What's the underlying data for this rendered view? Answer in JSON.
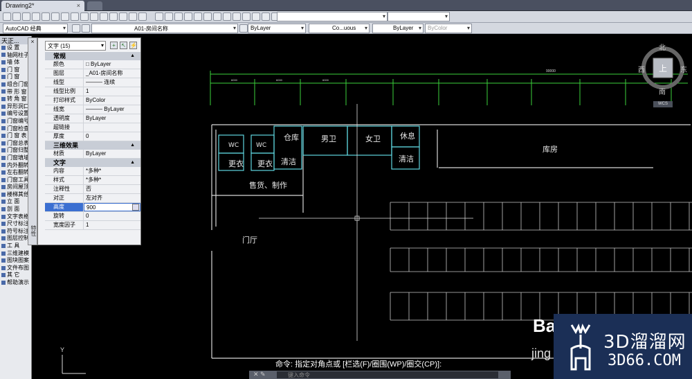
{
  "tabs": {
    "drawing": "Drawing2*",
    "close": "×"
  },
  "toolbar2": {
    "workspace": "AutoCAD 经典",
    "layer": "A01-房间名称",
    "color": "ByLayer",
    "linetype": "Co...uous",
    "lineweight": "ByLayer",
    "plotstyle": "ByColor"
  },
  "left_palette": {
    "header": "天正...",
    "items": [
      "设 置",
      "轴网柱子",
      "墙 体",
      "门 窗",
      "门 窗",
      "组合门窗",
      "带 形 窗",
      "转 角 窗",
      "异形洞口",
      "编号设置",
      "门窗编号",
      "门窗检查",
      "门 窗 表",
      "门窗总表",
      "门窗归整",
      "门窗填墙",
      "内外翻转",
      "左右翻转",
      "门窗工具",
      "房间屋顶",
      "楼梯其他",
      "立 面",
      "剖 面",
      "文字表格",
      "尺寸标注",
      "符号标注",
      "图层控制",
      "工 具",
      "三维建模",
      "图块图案",
      "文件布图",
      "其 它",
      "帮助演示"
    ]
  },
  "side_strip": {
    "close": "×",
    "label": "特性"
  },
  "properties": {
    "selector": "文字 (15)",
    "sections": [
      {
        "title": "常规",
        "rows": [
          {
            "k": "颜色",
            "v": "□ ByLayer"
          },
          {
            "k": "图层",
            "v": "_A01-房间名称"
          },
          {
            "k": "线型",
            "v": "——— 连续"
          },
          {
            "k": "线型比例",
            "v": "1"
          },
          {
            "k": "打印样式",
            "v": "ByColor"
          },
          {
            "k": "线宽",
            "v": "——— ByLayer"
          },
          {
            "k": "透明度",
            "v": "ByLayer"
          },
          {
            "k": "超链接",
            "v": ""
          },
          {
            "k": "厚度",
            "v": "0"
          }
        ]
      },
      {
        "title": "三维效果",
        "rows": [
          {
            "k": "材质",
            "v": "ByLayer"
          }
        ]
      },
      {
        "title": "文字",
        "rows": [
          {
            "k": "内容",
            "v": "*多种*"
          },
          {
            "k": "样式",
            "v": "*多种*"
          },
          {
            "k": "注释性",
            "v": "否"
          },
          {
            "k": "对正",
            "v": "左对齐"
          },
          {
            "k": "高度",
            "v": "900"
          },
          {
            "k": "旋转",
            "v": "0"
          },
          {
            "k": "宽度因子",
            "v": "1"
          }
        ]
      }
    ]
  },
  "viewcube": {
    "north": "北",
    "south": "南",
    "east": "东",
    "west": "西",
    "face": "上",
    "wcs": "WCS"
  },
  "rooms": {
    "wc1": "WC",
    "wc2": "WC",
    "cangku": "仓库",
    "nanwei": "男卫",
    "nvwei": "女卫",
    "xiuxi": "休息",
    "gengyi1": "更衣",
    "gengyi2": "更衣",
    "qingjie1": "清洁",
    "qingjie2": "清洁",
    "kufang": "库房",
    "shouhuo": "售货、制作",
    "menting": "门厅"
  },
  "dims": {
    "total": "90000",
    "seg": "6000"
  },
  "command": {
    "prompt": "命令: 指定对角点或 [栏选(F)/圈围(WP)/圈交(CP)]:",
    "input_placeholder": "键入命令"
  },
  "watermark": {
    "brand_cn": "3D溜溜网",
    "brand_url": "3D66.COM",
    "bai": "Bai",
    "jing": "jing"
  },
  "axis": {
    "y": "Y"
  }
}
